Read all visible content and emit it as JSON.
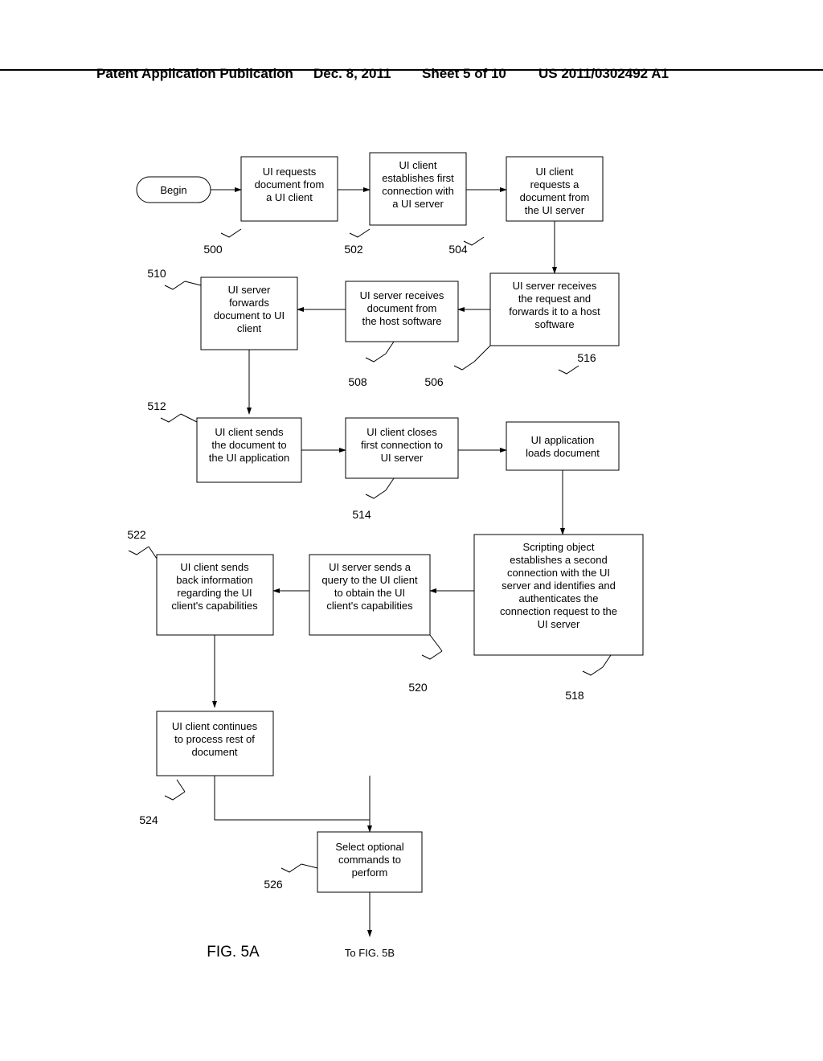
{
  "header": {
    "pub": "Patent Application Publication",
    "date": "Dec. 8, 2011",
    "sheet": "Sheet 5 of 10",
    "number": "US 2011/0302492 A1"
  },
  "begin": "Begin",
  "boxes": {
    "b500": "UI requests document from a UI client",
    "b502": "UI client establishes first connection with a UI server",
    "b504": "UI client requests a document from the UI server",
    "b506": "UI server receives the request and forwards it to a host software",
    "b508": "UI server receives document from the host software",
    "b510": "UI server forwards document to UI client",
    "b512": "UI client sends the document to the UI application",
    "b514": "UI client closes first connection to UI server",
    "b516": "UI application loads document",
    "b518": "Scripting object establishes a second connection with the UI server and identifies and authenticates the connection request to the UI server",
    "b520": "UI server sends a query to the UI client to obtain the UI client's capabilities",
    "b522": "UI client sends back information regarding the UI client's capabilities",
    "b524": "UI client continues to process rest of document",
    "b526": "Select optional commands to perform"
  },
  "labels": {
    "n500": "500",
    "n502": "502",
    "n504": "504",
    "n506": "506",
    "n508": "508",
    "n510": "510",
    "n512": "512",
    "n514": "514",
    "n516": "516",
    "n518": "518",
    "n520": "520",
    "n522": "522",
    "n524": "524",
    "n526": "526"
  },
  "fig": "FIG. 5A",
  "continuation": "To FIG. 5B"
}
